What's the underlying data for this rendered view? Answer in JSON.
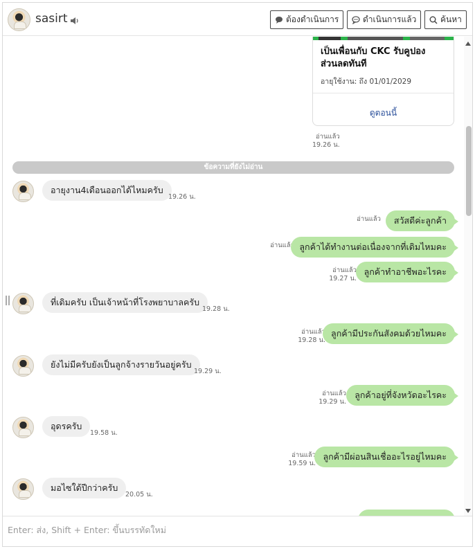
{
  "header": {
    "username": "sasirt",
    "speaker_icon": "speaker-icon",
    "buttons": [
      {
        "label": "ต้องดำเนินการ",
        "icon": "chat-bubble-icon"
      },
      {
        "label": "ดำเนินการแล้ว",
        "icon": "chat-bubble-icon"
      },
      {
        "label": "ค้นหา",
        "icon": "search-icon"
      }
    ]
  },
  "coupon": {
    "title": "เป็นเพื่อนกับ CKC รับคูปองส่วนลดทันที",
    "expiry": "อายุใช้งาน: ถึง 01/01/2029",
    "link_label": "ดูตอนนี้",
    "read_label": "อ่านแล้ว",
    "time": "19.26 น."
  },
  "unread_divider": "ข้อความที่ยังไม่อ่าน",
  "messages": [
    {
      "dir": "in",
      "text": "อายุงาน4เดือนออกได้ไหมครับ",
      "time": "19.26 น."
    },
    {
      "dir": "out",
      "text": "สวัสดีค่ะลูกค้า",
      "read": "อ่านแล้ว",
      "time": ""
    },
    {
      "dir": "out",
      "text": "ลูกค้าได้ทำงานต่อเนื่องจากที่เดิมไหมคะ",
      "read": "อ่านแล้ว",
      "time": ""
    },
    {
      "dir": "out",
      "text": "ลูกค้าทำอาชีพอะไรคะ",
      "read": "อ่านแล้ว",
      "time": "19.27 น."
    },
    {
      "dir": "in",
      "text": "ที่เดิมครับ เป็นเจ้าหน้าที่โรงพยาบาลครับ",
      "time": "19.28 น."
    },
    {
      "dir": "out",
      "text": "ลูกค้ามีประกันสังคมด้วยไหมคะ",
      "read": "อ่านแล้ว",
      "time": "19.28 น."
    },
    {
      "dir": "in",
      "text": "ยังไม่มีครับยังเป็นลูกจ้างรายวันอยู่ครับ",
      "time": "19.29 น."
    },
    {
      "dir": "out",
      "text": "ลูกค้าอยู่ที่จังหวัดอะไรคะ",
      "read": "อ่านแล้ว",
      "time": "19.29 น."
    },
    {
      "dir": "in",
      "text": "อุดรครับ",
      "time": "19.58 น."
    },
    {
      "dir": "out",
      "text": "ลูกค้ามีผ่อนสินเชื่ออะไรอยู่ไหมคะ",
      "read": "อ่านแล้ว",
      "time": "19.59 น."
    },
    {
      "dir": "in",
      "text": "มอไซใด้ปีกว่าครับ",
      "time": "20.05 น."
    }
  ],
  "composer": {
    "placeholder": "Enter: ส่ง, Shift + Enter: ขึ้นบรรทัดใหม่"
  },
  "colors": {
    "incoming_bubble": "#efefef",
    "outgoing_bubble": "#b9e6a5",
    "link": "#2a4f9a"
  }
}
